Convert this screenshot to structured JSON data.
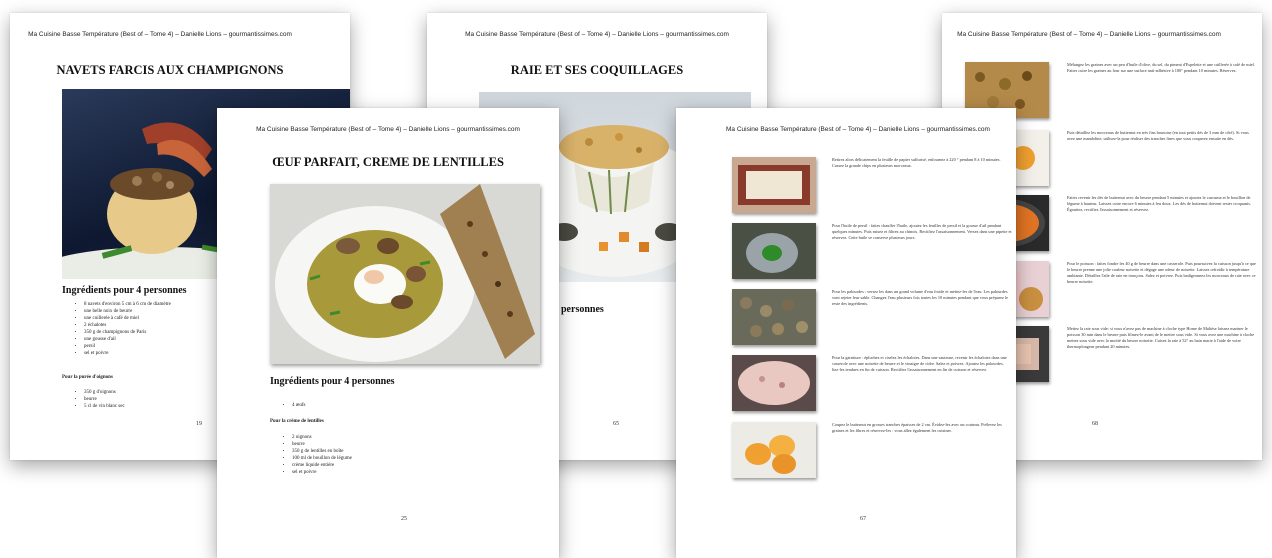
{
  "header": "Ma Cuisine Basse Température (Best of – Tome 4) – Danielle Lions – gourmantissimes.com",
  "page19": {
    "title": "NAVETS FARCIS AUX CHAMPIGNONS",
    "ingredients_title": "Ingrédients pour 4 personnes",
    "ingredients": [
      "8 navets d'environ 5 cm à 6 cm de diamètre",
      "une belle noix de beurre",
      "une cuillerée à café de miel",
      "2 échalotes",
      "350 g de champignons de Paris",
      "une gousse d'ail",
      "persil",
      "sel et poivre"
    ],
    "sub_title": "Pour la purée d'oignons",
    "sub_items": [
      "350 g d'oignons",
      "beurre",
      "5 cl de vin blanc sec"
    ],
    "page_number": "19"
  },
  "page65": {
    "title": "RAIE ET SES COQUILLAGES",
    "ingredients_fragment": "personnes",
    "page_number": "65"
  },
  "page25": {
    "title": "ŒUF PARFAIT, CREME DE LENTILLES",
    "ingredients_title": "Ingrédients pour 4 personnes",
    "ingredients": [
      "4 œufs"
    ],
    "sub_title": "Pour la crème de lentilles",
    "sub_items": [
      "2 oignons",
      "beurre",
      "350 g de lentilles en boîte",
      "100 ml de bouillon de légume",
      "crème liquide entière",
      "sel et poivre"
    ],
    "page_number": "25"
  },
  "page67": {
    "steps": [
      "Retirez alors délicatement la feuille de papier sulfurisé, enfournez à 220 ° pendant 8 à 10 minutes. Cassez la grande chips en plusieurs morceaux.",
      "Pour l'huile de persil : faites chauffer l'huile, ajoutez les feuilles de persil et la gousse d'ail pendant quelques minutes. Puis mixez et filtrez au chinois. Rectifiez l'assaisonnement. Versez dans une pipette et réservez. Cette huile se conserve plusieurs jours.",
      "Pour les palourdes : versez les dans un grand volume d'eau froide et mettez-les de l'eau. Les palourdes vont rejeter leur sable. Changez l'eau plusieurs fois toutes les 10 minutes pendant que vous préparez le reste des ingrédients.",
      "Pour la garniture : épluchez et ciselez les échalotes. Dans une sauteuse, revenir les échalotes dans une casserole avec une noisette de beurre et le vinaigre de cidre. Salez et poivrez. Ajoutez les palourdes, liez-les tendues en fin de cuisson. Rectifiez l'assaisonnement en fin de cuisson et réservez.",
      "Coupez le butternut en grosses tranches épaisses de 2 cm. Évidez-les avec un couteau. Prélevez les graines et les fibres et réservez-les : vous allez également les cuisiner."
    ],
    "page_number": "67"
  },
  "page68": {
    "steps": [
      "Mélangez les graines avec un peu d'huile d'olive, du sel, du piment d'Espelette et une cuillerée à café de miel. Faites cuire les graines au four sur une surface anti-adhésive à 180° pendant 10 minutes. Réservez.",
      "Puis détaillez les morceaux de butternut en très fins brunoise (en tout petits dés de 3 mm de côté). Si vous avez une mandoline, utilisez-la pour réaliser des tranches fines que vous couperez ensuite en dés.",
      "Faites revenir les dés de butternut avec du beurre pendant 5 minutes et ajoutez le curcuma et le bouillon de légume à hauteur. Laissez cuire encore 6 minutes à feu doux. Les dés de butternut doivent rester croquants. Égouttez, rectifiez l'assaisonnement et réservez.",
      "Pour le poisson : faites fondre les 40 g de beurre dans une casserole. Puis poursuivez la cuisson jusqu'à ce que le beurre prenne une jolie couleur noisette et dégage une odeur de noisette. Laissez refroidir à température ambiante. Détaillez l'aile de raie en tronçons. Salez et poivrez. Puis badigeonnez les morceaux de raie avec ce beurre noisette.",
      "Mettez la raie sous vide: si vous n'avez pas de machine à cloche type Home de Maltése laissez mariner le poisson 30 min dans le beurre puis filmez-le avant de le mettre sous vide. Si vous avez une machine à cloche mettez sous vide avec la moitié du beurre noisette. Cuisez la raie à 52° au bain marie à l'aide de votre thermoplongeur pendant 20 minutes."
    ],
    "page_number": "68"
  }
}
